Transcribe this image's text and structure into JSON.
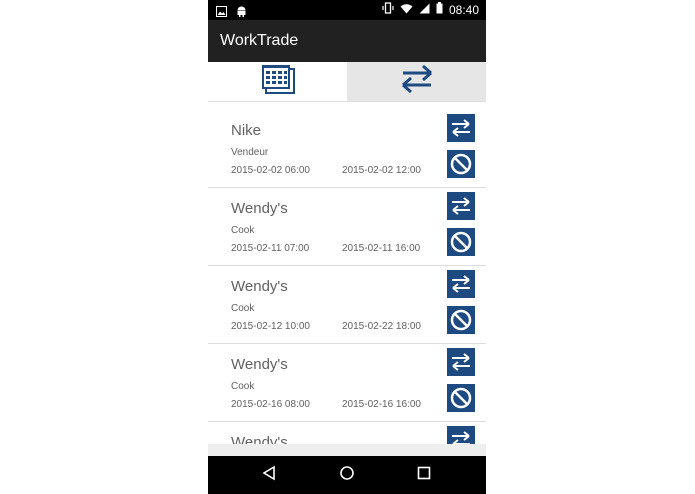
{
  "colors": {
    "accent": "#1e4a82",
    "appbar": "#212121",
    "statusbar": "#000000",
    "text": "#616161",
    "tab_active_bg": "#e6e6e6"
  },
  "statusbar": {
    "time": "08:40",
    "icons": [
      "image-icon",
      "android-icon",
      "vibrate-icon",
      "wifi-icon",
      "signal-icon",
      "battery-icon"
    ]
  },
  "app": {
    "title": "WorkTrade"
  },
  "tabs": [
    {
      "icon": "calendar-icon",
      "active": false
    },
    {
      "icon": "swap-arrows-icon",
      "active": true
    }
  ],
  "shifts": [
    {
      "company": "Nike",
      "role": "Vendeur",
      "start": "2015-02-02 06:00",
      "end": "2015-02-02 12:00"
    },
    {
      "company": "Wendy's",
      "role": "Cook",
      "start": "2015-02-11 07:00",
      "end": "2015-02-11 16:00"
    },
    {
      "company": "Wendy's",
      "role": "Cook",
      "start": "2015-02-12 10:00",
      "end": "2015-02-22 18:00"
    },
    {
      "company": "Wendy's",
      "role": "Cook",
      "start": "2015-02-16 08:00",
      "end": "2015-02-16 16:00"
    },
    {
      "company": "Wendy's",
      "role": "",
      "start": "",
      "end": ""
    }
  ],
  "navbar": {
    "icons": [
      "back-icon",
      "home-icon",
      "recents-icon"
    ]
  }
}
